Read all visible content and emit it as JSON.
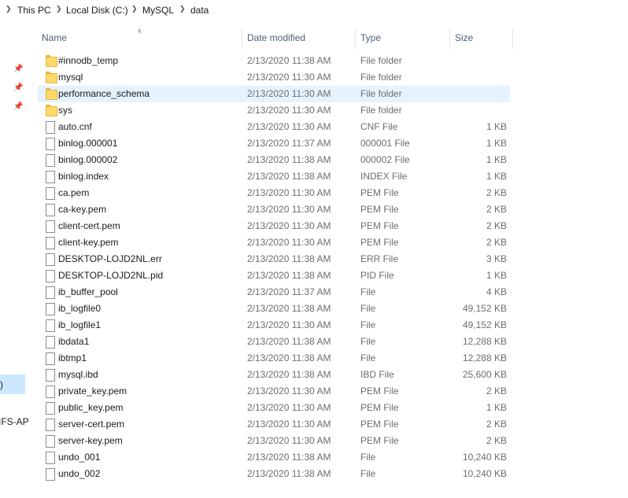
{
  "breadcrumb": [
    "This PC",
    "Local Disk (C:)",
    "MySQL",
    "data"
  ],
  "columns": {
    "name": "Name",
    "date": "Date modified",
    "type": "Type",
    "size": "Size"
  },
  "nav": {
    "partial_item": ")",
    "partial_label": "IFS-AP"
  },
  "files": [
    {
      "name": "#innodb_temp",
      "date": "2/13/2020 11:38 AM",
      "type": "File folder",
      "size": "",
      "kind": "folder"
    },
    {
      "name": "mysql",
      "date": "2/13/2020 11:30 AM",
      "type": "File folder",
      "size": "",
      "kind": "folder"
    },
    {
      "name": "performance_schema",
      "date": "2/13/2020 11:30 AM",
      "type": "File folder",
      "size": "",
      "kind": "folder",
      "hover": true
    },
    {
      "name": "sys",
      "date": "2/13/2020 11:30 AM",
      "type": "File folder",
      "size": "",
      "kind": "folder"
    },
    {
      "name": "auto.cnf",
      "date": "2/13/2020 11:30 AM",
      "type": "CNF File",
      "size": "1 KB",
      "kind": "file"
    },
    {
      "name": "binlog.000001",
      "date": "2/13/2020 11:37 AM",
      "type": "000001 File",
      "size": "1 KB",
      "kind": "file"
    },
    {
      "name": "binlog.000002",
      "date": "2/13/2020 11:38 AM",
      "type": "000002 File",
      "size": "1 KB",
      "kind": "file"
    },
    {
      "name": "binlog.index",
      "date": "2/13/2020 11:38 AM",
      "type": "INDEX File",
      "size": "1 KB",
      "kind": "file"
    },
    {
      "name": "ca.pem",
      "date": "2/13/2020 11:30 AM",
      "type": "PEM File",
      "size": "2 KB",
      "kind": "file"
    },
    {
      "name": "ca-key.pem",
      "date": "2/13/2020 11:30 AM",
      "type": "PEM File",
      "size": "2 KB",
      "kind": "file"
    },
    {
      "name": "client-cert.pem",
      "date": "2/13/2020 11:30 AM",
      "type": "PEM File",
      "size": "2 KB",
      "kind": "file"
    },
    {
      "name": "client-key.pem",
      "date": "2/13/2020 11:30 AM",
      "type": "PEM File",
      "size": "2 KB",
      "kind": "file"
    },
    {
      "name": "DESKTOP-LOJD2NL.err",
      "date": "2/13/2020 11:38 AM",
      "type": "ERR File",
      "size": "3 KB",
      "kind": "file"
    },
    {
      "name": "DESKTOP-LOJD2NL.pid",
      "date": "2/13/2020 11:38 AM",
      "type": "PID File",
      "size": "1 KB",
      "kind": "file"
    },
    {
      "name": "ib_buffer_pool",
      "date": "2/13/2020 11:37 AM",
      "type": "File",
      "size": "4 KB",
      "kind": "file"
    },
    {
      "name": "ib_logfile0",
      "date": "2/13/2020 11:38 AM",
      "type": "File",
      "size": "49,152 KB",
      "kind": "file"
    },
    {
      "name": "ib_logfile1",
      "date": "2/13/2020 11:30 AM",
      "type": "File",
      "size": "49,152 KB",
      "kind": "file"
    },
    {
      "name": "ibdata1",
      "date": "2/13/2020 11:38 AM",
      "type": "File",
      "size": "12,288 KB",
      "kind": "file"
    },
    {
      "name": "ibtmp1",
      "date": "2/13/2020 11:38 AM",
      "type": "File",
      "size": "12,288 KB",
      "kind": "file"
    },
    {
      "name": "mysql.ibd",
      "date": "2/13/2020 11:38 AM",
      "type": "IBD File",
      "size": "25,600 KB",
      "kind": "file"
    },
    {
      "name": "private_key.pem",
      "date": "2/13/2020 11:30 AM",
      "type": "PEM File",
      "size": "2 KB",
      "kind": "file"
    },
    {
      "name": "public_key.pem",
      "date": "2/13/2020 11:30 AM",
      "type": "PEM File",
      "size": "1 KB",
      "kind": "file"
    },
    {
      "name": "server-cert.pem",
      "date": "2/13/2020 11:30 AM",
      "type": "PEM File",
      "size": "2 KB",
      "kind": "file"
    },
    {
      "name": "server-key.pem",
      "date": "2/13/2020 11:30 AM",
      "type": "PEM File",
      "size": "2 KB",
      "kind": "file"
    },
    {
      "name": "undo_001",
      "date": "2/13/2020 11:38 AM",
      "type": "File",
      "size": "10,240 KB",
      "kind": "file"
    },
    {
      "name": "undo_002",
      "date": "2/13/2020 11:38 AM",
      "type": "File",
      "size": "10,240 KB",
      "kind": "file"
    }
  ],
  "colors": {
    "hover_row": "#e5f3ff",
    "nav_selected": "#cce8ff",
    "folder": "#ffd86b",
    "header_text": "#4c607a"
  },
  "icons": {
    "folder": "folder-icon",
    "file": "file-icon",
    "pin": "pin-icon",
    "sort": "sort-up-icon",
    "chevron": "chevron-right-icon"
  }
}
